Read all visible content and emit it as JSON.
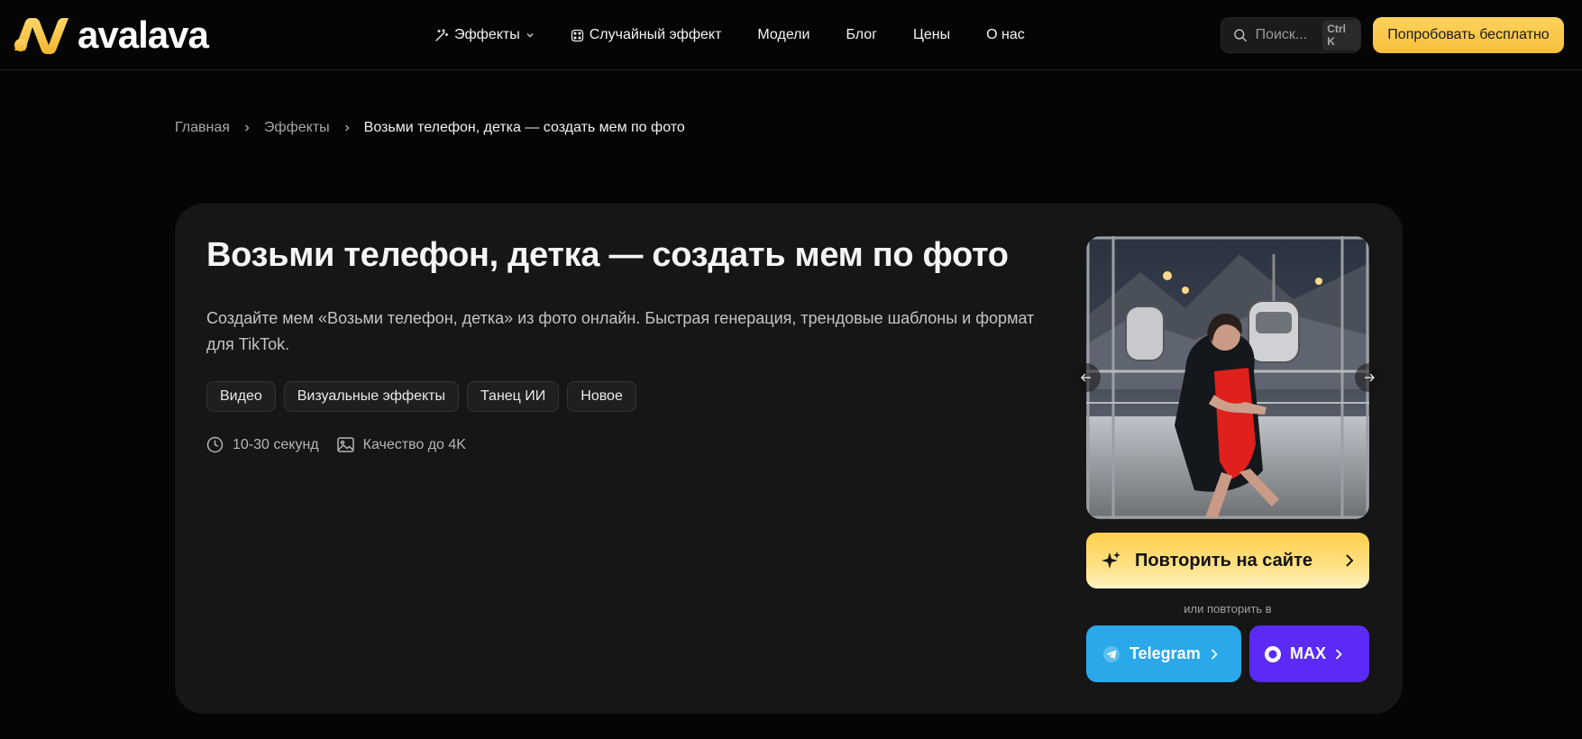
{
  "header": {
    "logo_text": "avalava",
    "nav": [
      {
        "label": "Эффекты",
        "icon": "magic-wand-icon",
        "has_dropdown": true
      },
      {
        "label": "Случайный эффект",
        "icon": "dice-icon"
      },
      {
        "label": "Модели"
      },
      {
        "label": "Блог"
      },
      {
        "label": "Цены"
      },
      {
        "label": "О нас"
      }
    ],
    "search": {
      "placeholder": "Поиск...",
      "shortcut": "Ctrl K"
    },
    "cta_label": "Попробовать бесплатно"
  },
  "breadcrumb": {
    "items": [
      "Главная",
      "Эффекты"
    ],
    "current": "Возьми телефон, детка — создать мем по фото"
  },
  "effect": {
    "title": "Возьми телефон, детка — создать мем по фото",
    "description": "Создайте мем «Возьми телефон, детка» из фото онлайн. Быстрая генерация, трендовые шаблоны и формат для TikTok.",
    "tags": [
      "Видео",
      "Визуальные эффекты",
      "Танец ИИ",
      "Новое"
    ],
    "meta": {
      "duration": "10-30 секунд",
      "quality": "Качество до 4K"
    }
  },
  "actions": {
    "repeat_label": "Повторить на сайте",
    "or_text": "или повторить в",
    "telegram_label": "Telegram",
    "max_label": "MAX"
  },
  "colors": {
    "accent": "#f6bf3a",
    "telegram": "#2aa8ea",
    "max": "#5b2bf5",
    "card_bg": "#161616",
    "page_bg": "#050505"
  }
}
